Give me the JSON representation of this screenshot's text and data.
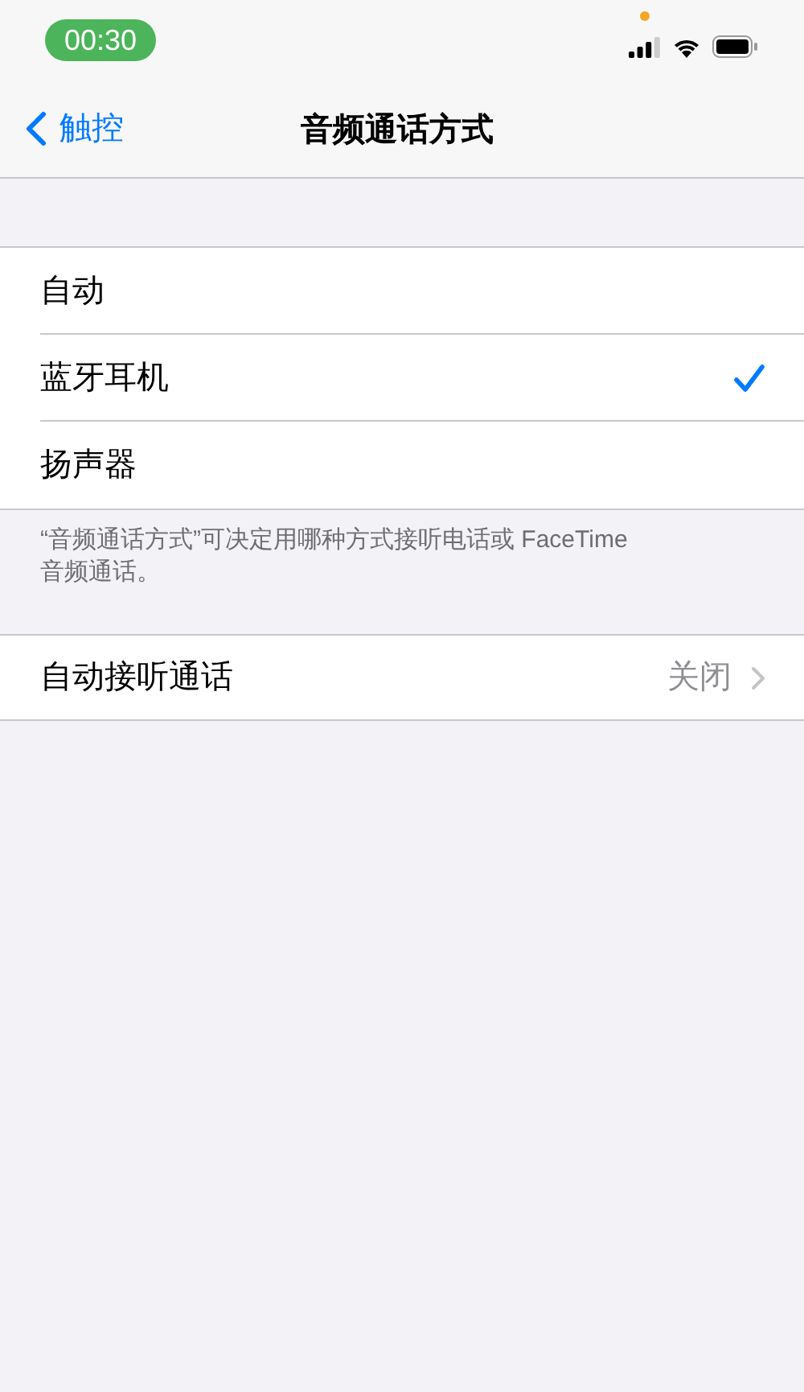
{
  "status_bar": {
    "time": "00:30"
  },
  "nav": {
    "back": "触控",
    "title": "音频通话方式"
  },
  "options": [
    {
      "label": "自动",
      "selected": false
    },
    {
      "label": "蓝牙耳机",
      "selected": true
    },
    {
      "label": "扬声器",
      "selected": false
    }
  ],
  "footer": "“音频通话方式”可决定用哪种方式接听电话或 FaceTime 音频通话。",
  "auto_answer": {
    "label": "自动接听通话",
    "value": "关闭"
  }
}
